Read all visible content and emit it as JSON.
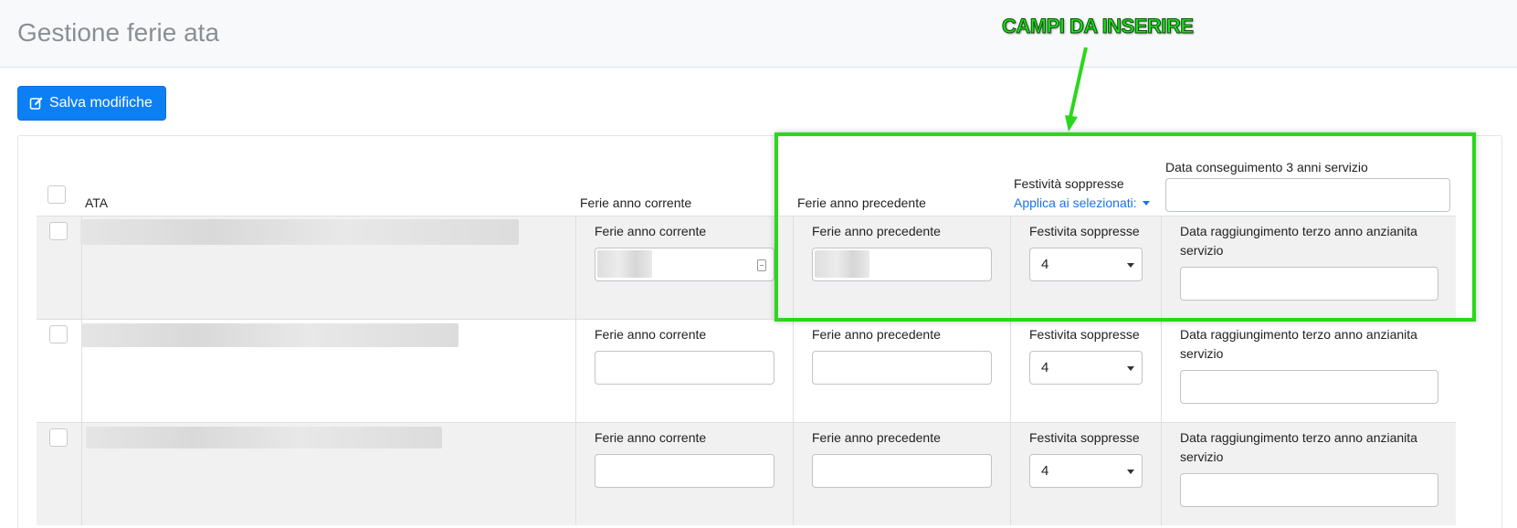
{
  "page": {
    "title": "Gestione ferie ata"
  },
  "toolbar": {
    "save_label": "Salva modifiche"
  },
  "table": {
    "headers": {
      "ata": "ATA",
      "ferie_corrente": "Ferie anno corrente",
      "ferie_precedente": "Ferie anno precedente",
      "festivita": "Festività soppresse",
      "applica": "Applica ai selezionati:",
      "data": "Data conseguimento 3 anni servizio"
    },
    "rows": [
      {
        "ferie_corrente_label": "Ferie anno corrente",
        "ferie_precedente_label": "Ferie anno precedente",
        "festivita_label": "Festivita soppresse",
        "festivita_value": "4",
        "data_label": "Data raggiungimento terzo anno anzianita servizio"
      },
      {
        "ferie_corrente_label": "Ferie anno corrente",
        "ferie_precedente_label": "Ferie anno precedente",
        "festivita_label": "Festivita soppresse",
        "festivita_value": "4",
        "data_label": "Data raggiungimento terzo anno anzianita servizio"
      },
      {
        "ferie_corrente_label": "Ferie anno corrente",
        "ferie_precedente_label": "Ferie anno precedente",
        "festivita_label": "Festivita soppresse",
        "festivita_value": "4",
        "data_label": "Data raggiungimento terzo anno anzianita servizio"
      }
    ]
  },
  "annotation": {
    "text": "CAMPI DA INSERIRE",
    "color": "#2ad81a"
  },
  "colors": {
    "primary": "#0d7ff5",
    "link": "#1a73e8",
    "row_shade": "#f1f1f1"
  }
}
